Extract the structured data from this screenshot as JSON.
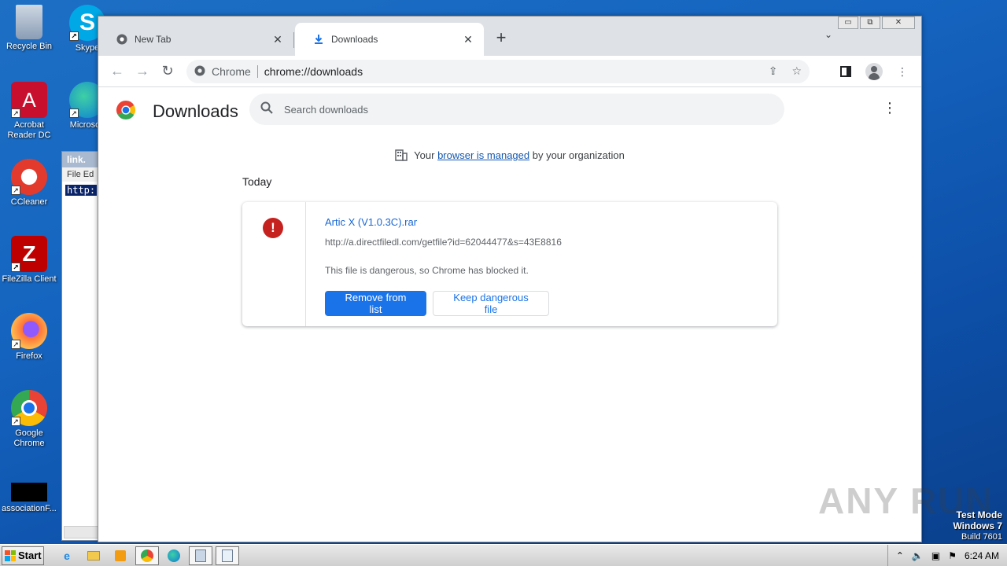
{
  "desktop": {
    "icons": [
      {
        "label": "Recycle Bin"
      },
      {
        "label": "Skype"
      },
      {
        "label": "Acrobat Reader DC"
      },
      {
        "label": "Microsoft"
      },
      {
        "label": "CCleaner"
      },
      {
        "label": "FileZilla Client"
      },
      {
        "label": "Firefox"
      },
      {
        "label": "Google Chrome"
      },
      {
        "label": "associationF..."
      }
    ],
    "notepad": {
      "title": "link.",
      "menu": "File  Ed",
      "selected_text": "http:"
    }
  },
  "browser": {
    "tabs": [
      {
        "title": "New Tab",
        "active": false
      },
      {
        "title": "Downloads",
        "active": true
      }
    ],
    "omnibox": {
      "site_label": "Chrome",
      "url": "chrome://downloads"
    }
  },
  "downloads_page": {
    "title": "Downloads",
    "search_placeholder": "Search downloads",
    "managed_notice": {
      "prefix": "Your ",
      "link": "browser is managed",
      "suffix": " by your organization"
    },
    "date_group": "Today",
    "item": {
      "file_name": "Artic X (V1.0.3C).rar",
      "url": "http://a.directfiledl.com/getfile?id=62044477&s=43E8816",
      "status": "This file is dangerous, so Chrome has blocked it.",
      "danger_glyph": "!",
      "primary_button": "Remove from list",
      "secondary_button": "Keep dangerous file"
    }
  },
  "watermark": "ANY RUN",
  "test_mode": {
    "line1": "Test Mode",
    "line2": "Windows 7",
    "line3": "Build 7601"
  },
  "taskbar": {
    "start_label": "Start",
    "clock": "6:24 AM"
  },
  "colors": {
    "accent": "#1a73e8",
    "danger": "#c5221f",
    "desktop": "#1565c0"
  }
}
